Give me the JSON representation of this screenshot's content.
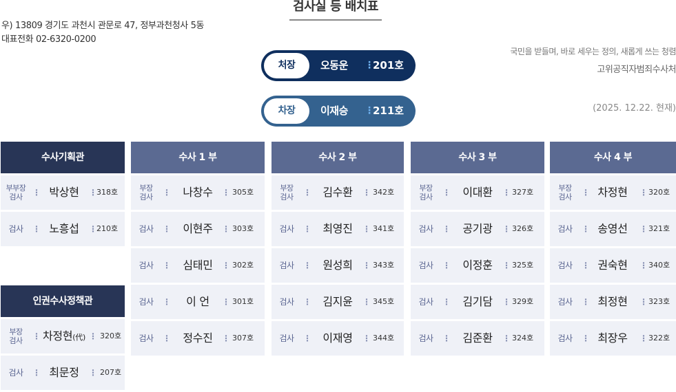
{
  "page_title": "검사실 등 배치표",
  "address": {
    "line1": "우) 13809 경기도 과천시 관문로 47, 정부과천청사 5동",
    "line2": "대표전화 02-6320-0200"
  },
  "slogan": {
    "line1": "국민을 받들며, 바로 세우는 정의, 새롭게 쓰는 청렴",
    "line2": "고위공직자범죄수사처"
  },
  "as_of": "(2025. 12.22. 현재)",
  "leaders": [
    {
      "role": "처장",
      "name": "오동운",
      "room": "201호"
    },
    {
      "role": "차장",
      "name": "이재승",
      "room": "211호"
    }
  ],
  "departments": [
    {
      "name": "수사기획관",
      "members": [
        {
          "role": "부부장\n검사",
          "name": "박상현",
          "room": "318호"
        },
        {
          "role": "검사",
          "name": "노흥섭",
          "room": "210호"
        }
      ]
    },
    {
      "name": "인권수사정책관",
      "members": [
        {
          "role": "부장\n검사",
          "name": "차정현",
          "name_suffix": "(代)",
          "room": "320호"
        },
        {
          "role": "검사",
          "name": "최문정",
          "room": "207호"
        }
      ]
    },
    {
      "name": "수사 1 부",
      "members": [
        {
          "role": "부장\n검사",
          "name": "나창수",
          "room": "305호"
        },
        {
          "role": "검사",
          "name": "이현주",
          "room": "303호"
        },
        {
          "role": "검사",
          "name": "심태민",
          "room": "302호"
        },
        {
          "role": "검사",
          "name": "이 언",
          "room": "301호"
        },
        {
          "role": "검사",
          "name": "정수진",
          "room": "307호"
        }
      ]
    },
    {
      "name": "수사 2 부",
      "members": [
        {
          "role": "부장\n검사",
          "name": "김수환",
          "room": "342호"
        },
        {
          "role": "검사",
          "name": "최영진",
          "room": "341호"
        },
        {
          "role": "검사",
          "name": "원성희",
          "room": "343호"
        },
        {
          "role": "검사",
          "name": "김지윤",
          "room": "345호"
        },
        {
          "role": "검사",
          "name": "이재영",
          "room": "344호"
        }
      ]
    },
    {
      "name": "수사 3 부",
      "members": [
        {
          "role": "부장\n검사",
          "name": "이대환",
          "room": "327호"
        },
        {
          "role": "검사",
          "name": "공기광",
          "room": "326호"
        },
        {
          "role": "검사",
          "name": "이정훈",
          "room": "325호"
        },
        {
          "role": "검사",
          "name": "김기담",
          "room": "329호"
        },
        {
          "role": "검사",
          "name": "김준환",
          "room": "324호"
        }
      ]
    },
    {
      "name": "수사 4 부",
      "members": [
        {
          "role": "부장\n검사",
          "name": "차정현",
          "room": "320호"
        },
        {
          "role": "검사",
          "name": "송영선",
          "room": "321호"
        },
        {
          "role": "검사",
          "name": "권숙현",
          "room": "340호"
        },
        {
          "role": "검사",
          "name": "최정현",
          "room": "323호"
        },
        {
          "role": "검사",
          "name": "최장우",
          "room": "322호"
        }
      ]
    }
  ]
}
